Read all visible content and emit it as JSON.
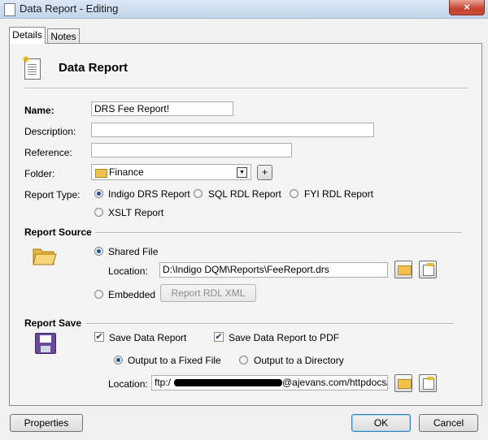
{
  "window": {
    "title": "Data Report - Editing",
    "close_label": "×"
  },
  "tabs": [
    {
      "label": "Details",
      "active": true
    },
    {
      "label": "Notes",
      "active": false
    }
  ],
  "header": {
    "title": "Data Report"
  },
  "form": {
    "name_label": "Name:",
    "name_value": "DRS Fee Report!",
    "description_label": "Description:",
    "description_value": "",
    "reference_label": "Reference:",
    "reference_value": "",
    "folder_label": "Folder:",
    "folder_value": "Finance",
    "add_folder_label": "+",
    "report_type_label": "Report Type:",
    "report_types": [
      {
        "label": "Indigo DRS Report",
        "selected": true
      },
      {
        "label": "SQL RDL Report",
        "selected": false
      },
      {
        "label": "FYI RDL Report",
        "selected": false
      },
      {
        "label": "XSLT Report",
        "selected": false
      }
    ]
  },
  "report_source": {
    "heading": "Report Source",
    "shared_file_label": "Shared File",
    "shared_file_selected": true,
    "location_label": "Location:",
    "location_value": "D:\\Indigo DQM\\Reports\\FeeReport.drs",
    "embedded_label": "Embedded",
    "embedded_selected": false,
    "report_rdl_xml_label": "Report RDL XML"
  },
  "report_save": {
    "heading": "Report Save",
    "save_data_report_label": "Save Data Report",
    "save_data_report_checked": true,
    "save_pdf_label": "Save Data Report to PDF",
    "save_pdf_checked": true,
    "output_fixed_label": "Output to a Fixed File",
    "output_fixed_selected": true,
    "output_dir_label": "Output to a Directory",
    "output_dir_selected": false,
    "location_label": "Location:",
    "location_prefix": "ftp:/",
    "location_suffix": "@ajevans.com/httpdocs/fil"
  },
  "footer": {
    "properties_label": "Properties",
    "ok_label": "OK",
    "cancel_label": "Cancel"
  },
  "colors": {
    "accent": "#1e4f9c",
    "titlebar": "#c4d6ec",
    "close": "#c7402d",
    "folder": "#f0c24d"
  }
}
